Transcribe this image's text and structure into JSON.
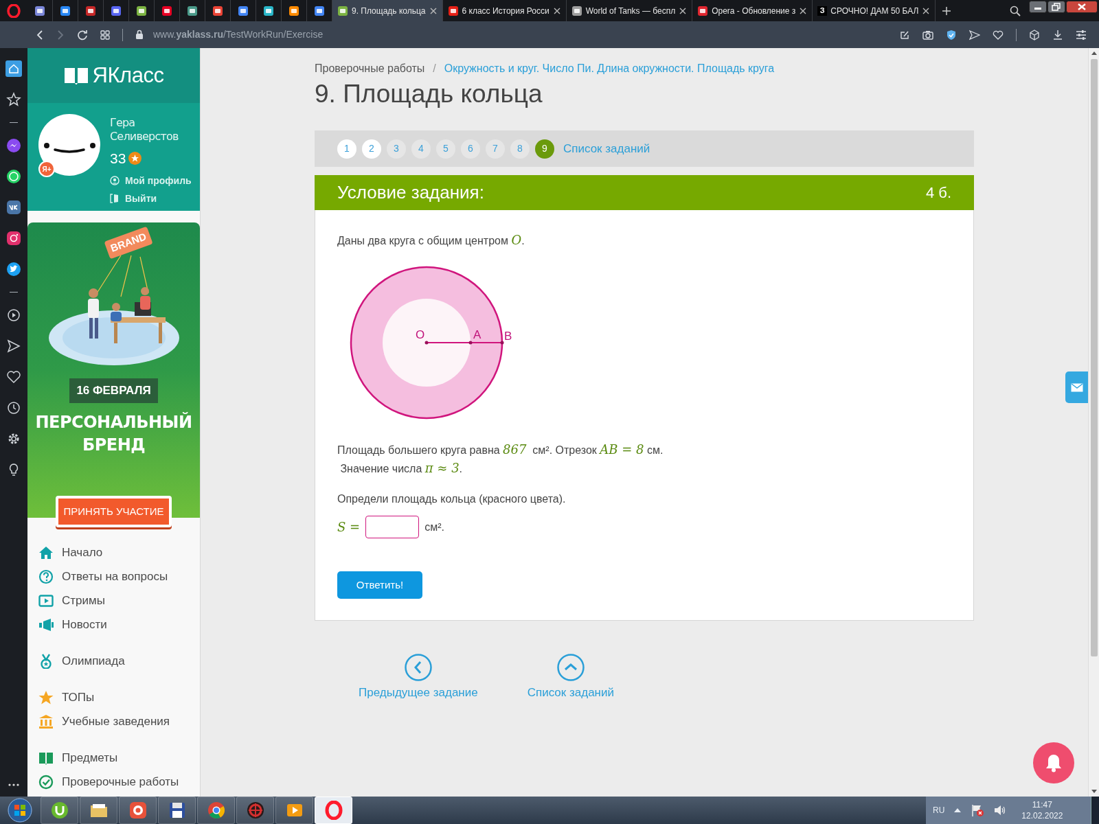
{
  "browser": {
    "tabs": [
      {
        "kind": "icon",
        "color": "#7a86d9",
        "selected": false
      },
      {
        "kind": "icon",
        "color": "#2787f5",
        "selected": false
      },
      {
        "kind": "icon",
        "color": "#c62828",
        "selected": false
      },
      {
        "kind": "icon",
        "color": "#5865f2",
        "selected": false
      },
      {
        "kind": "icon",
        "color": "#7cb342",
        "selected": false
      },
      {
        "kind": "icon",
        "color": "#e60023",
        "selected": false
      },
      {
        "kind": "icon",
        "color": "#4a9a8a",
        "selected": false
      },
      {
        "kind": "icon",
        "color": "#ea4335",
        "selected": false
      },
      {
        "kind": "icon",
        "color": "#4285f4",
        "selected": false
      },
      {
        "kind": "icon",
        "color": "#29b6c8",
        "selected": false
      },
      {
        "kind": "icon",
        "color": "#ff8a00",
        "selected": false
      },
      {
        "kind": "icon",
        "color": "#4285f4",
        "selected": false
      },
      {
        "kind": "page",
        "color": "#7cb342",
        "title": "9. Площадь кольца",
        "selected": true
      },
      {
        "kind": "page",
        "color": "#e62117",
        "title": "6 класс История Росси",
        "selected": false
      },
      {
        "kind": "page",
        "color": "#9e9e9e",
        "title": "World of Tanks — беспл",
        "selected": false
      },
      {
        "kind": "page",
        "color": "#e0262f",
        "title": "Opera - Обновление з",
        "selected": false
      },
      {
        "kind": "page",
        "color": "#000000",
        "favicon_text": "З",
        "title": "СРОЧНО! ДАМ 50 БАЛ",
        "selected": false
      }
    ],
    "url": "www.**yaklass.ru**/TestWorkRun/Exercise",
    "sidebar": [
      [
        {
          "kind": "home",
          "selected": true
        },
        {
          "kind": "star",
          "selected": false
        }
      ],
      [
        {
          "kind": "messenger",
          "selected": false
        },
        {
          "kind": "whatsapp",
          "selected": false
        },
        {
          "kind": "vk",
          "selected": false
        },
        {
          "kind": "instagram",
          "selected": false
        },
        {
          "kind": "twitter",
          "selected": false
        }
      ],
      [
        {
          "kind": "player",
          "selected": false
        },
        {
          "kind": "send",
          "selected": false
        },
        {
          "kind": "heart",
          "selected": false
        },
        {
          "kind": "clock",
          "selected": false
        },
        {
          "kind": "gear",
          "selected": false
        },
        {
          "kind": "bulb",
          "selected": false
        }
      ]
    ]
  },
  "site_sidebar": {
    "logo": "ЯКласс",
    "user": {
      "name": "Гера Селиверстов",
      "points": "33",
      "badge": "Я+",
      "links": [
        "Мой профиль",
        "Выйти"
      ]
    },
    "ad": {
      "sign": "BRAND",
      "date": "16 ФЕВРАЛЯ",
      "headline": "ПЕРСОНАЛЬНЫЙ БРЕНД",
      "button": "ПРИНЯТЬ УЧАСТИЕ"
    },
    "nav": [
      [
        {
          "kind": "home",
          "label": "Начало"
        },
        {
          "kind": "question",
          "label": "Ответы на вопросы"
        },
        {
          "kind": "play",
          "label": "Стримы"
        },
        {
          "kind": "megaphone",
          "label": "Новости"
        }
      ],
      [
        {
          "kind": "medal",
          "label": "Олимпиада"
        }
      ],
      [
        {
          "kind": "star",
          "label": "ТОПы"
        },
        {
          "kind": "school",
          "label": "Учебные заведения"
        }
      ],
      [
        {
          "kind": "book",
          "label": "Предметы"
        },
        {
          "kind": "check",
          "label": "Проверочные работы"
        }
      ]
    ]
  },
  "breadcrumb": {
    "parent": "Проверочные работы",
    "separator": "/",
    "current": "Окружность и круг. Число Пи. Длина окружности. Площадь круга"
  },
  "title": "9. Площадь кольца",
  "pager": {
    "items": [
      {
        "label": "1",
        "visited": true,
        "selected": false
      },
      {
        "label": "2",
        "visited": true,
        "selected": false
      },
      {
        "label": "3",
        "visited": false,
        "selected": false
      },
      {
        "label": "4",
        "visited": false,
        "selected": false
      },
      {
        "label": "5",
        "visited": false,
        "selected": false
      },
      {
        "label": "6",
        "visited": false,
        "selected": false
      },
      {
        "label": "7",
        "visited": false,
        "selected": false
      },
      {
        "label": "8",
        "visited": false,
        "selected": false
      },
      {
        "label": "9",
        "visited": false,
        "selected": true
      }
    ],
    "list_link": "Список заданий"
  },
  "task": {
    "heading": "Условие задания:",
    "points": "4 б.",
    "lines": [
      [
        {
          "kind": "text",
          "text": "Даны два круга с общим центром "
        },
        {
          "kind": "math",
          "text": "O"
        },
        {
          "kind": "text",
          "text": "."
        }
      ],
      {
        "kind": "diagram",
        "labels": [
          "O",
          "A",
          "B"
        ]
      },
      [
        {
          "kind": "text",
          "text": "Площадь большего круга равна "
        },
        {
          "kind": "math",
          "text": "867"
        },
        {
          "kind": "text",
          "text": "  см². Отрезок "
        },
        {
          "kind": "math",
          "text": "AB = 8"
        },
        {
          "kind": "text",
          "text": " см."
        }
      ],
      [
        {
          "kind": "text",
          "text": " Значение числа "
        },
        {
          "kind": "math",
          "text": "π ≈ 3"
        },
        {
          "kind": "text",
          "text": "."
        }
      ],
      [
        {
          "kind": "text",
          "text": "Определи площадь кольца (красного цвета)."
        }
      ]
    ],
    "answer": {
      "lhs": "S =",
      "unit": "см².",
      "focused": true
    },
    "submit": "Ответить!"
  },
  "bottom_nav": [
    {
      "kind": "prev",
      "label": "Предыдущее задание"
    },
    {
      "kind": "up",
      "label": "Список заданий"
    }
  ],
  "taskbar": {
    "apps": [
      {
        "kind": "utorrent",
        "selected": false
      },
      {
        "kind": "folder",
        "selected": false
      },
      {
        "kind": "redapp",
        "selected": false
      },
      {
        "kind": "floppy",
        "selected": false
      },
      {
        "kind": "chrome",
        "selected": false
      },
      {
        "kind": "game",
        "selected": false
      },
      {
        "kind": "media",
        "selected": false
      },
      {
        "kind": "opera",
        "selected": true
      }
    ],
    "language": "RU",
    "time": "11:47",
    "date": "12.02.2022"
  }
}
